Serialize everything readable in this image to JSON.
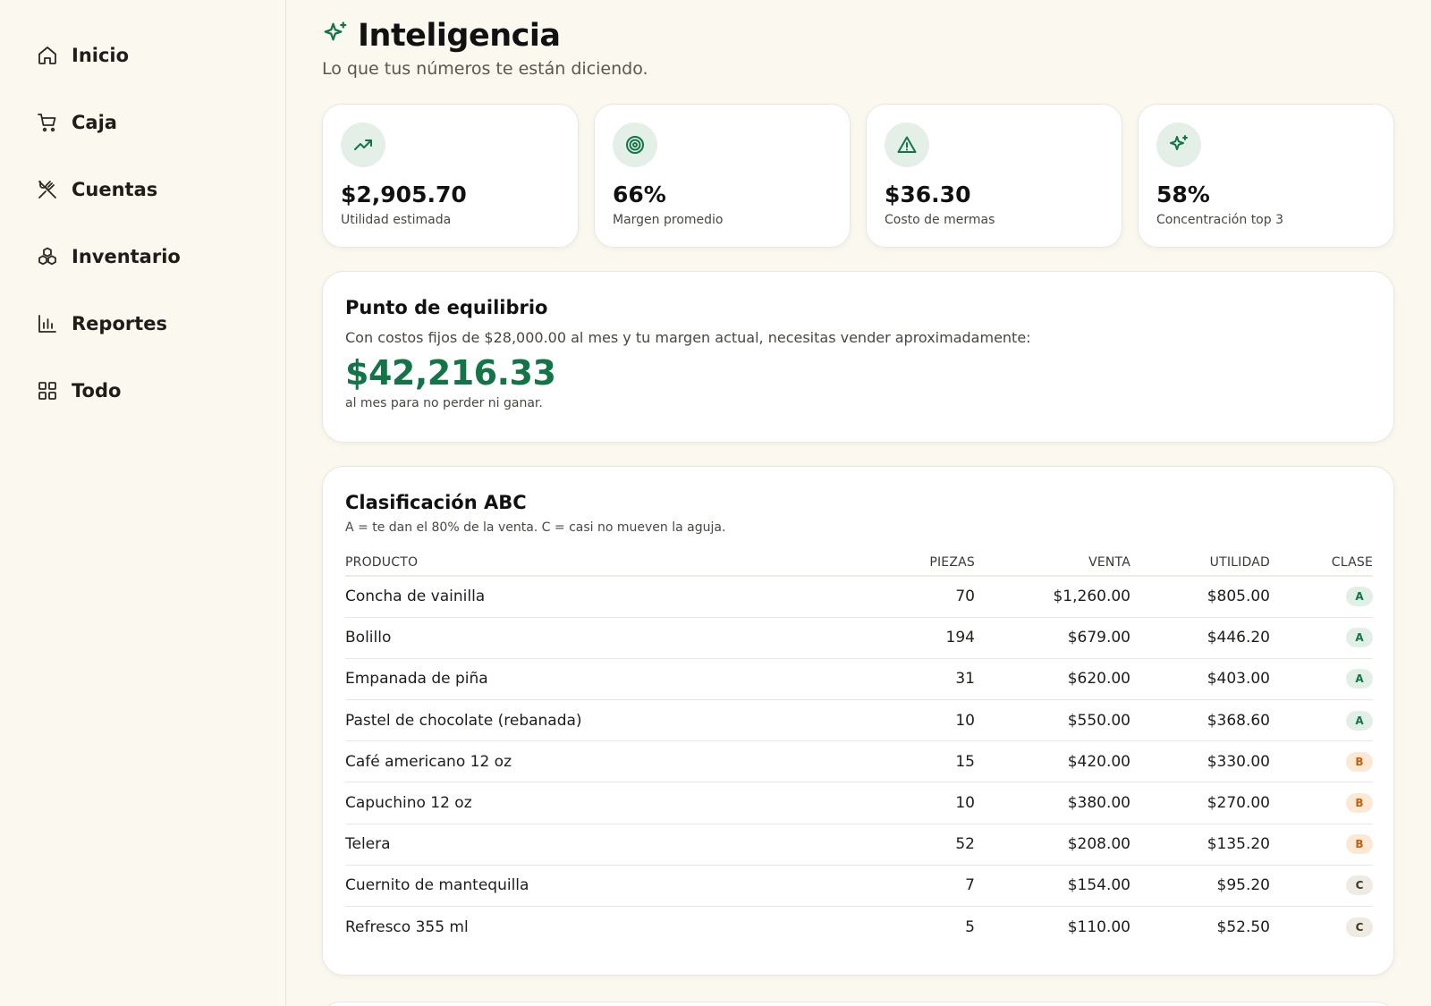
{
  "sidebar": {
    "items": [
      {
        "label": "Inicio",
        "icon": "home-icon"
      },
      {
        "label": "Caja",
        "icon": "cart-icon"
      },
      {
        "label": "Cuentas",
        "icon": "utensils-crossed-icon"
      },
      {
        "label": "Inventario",
        "icon": "boxes-icon"
      },
      {
        "label": "Reportes",
        "icon": "bar-chart-icon"
      },
      {
        "label": "Todo",
        "icon": "grid-icon"
      }
    ]
  },
  "header": {
    "title": "Inteligencia",
    "subtitle": "Lo que tus números te están diciendo.",
    "icon": "sparkles-icon"
  },
  "stats": [
    {
      "value": "$2,905.70",
      "label": "Utilidad estimada",
      "icon": "trending-up-icon"
    },
    {
      "value": "66%",
      "label": "Margen promedio",
      "icon": "target-icon"
    },
    {
      "value": "$36.30",
      "label": "Costo de mermas",
      "icon": "warning-icon"
    },
    {
      "value": "58%",
      "label": "Concentración top 3",
      "icon": "sparkles-icon"
    }
  ],
  "breakeven": {
    "title": "Punto de equilibrio",
    "description": "Con costos fijos de $28,000.00 al mes y tu margen actual, necesitas vender aproximadamente:",
    "value": "$42,216.33",
    "note": "al mes para no perder ni ganar."
  },
  "abc": {
    "title": "Clasificación ABC",
    "description": "A = te dan el 80% de la venta. C = casi no mueven la aguja.",
    "columns": {
      "product": "Producto",
      "pieces": "Piezas",
      "sale": "Venta",
      "profit": "Utilidad",
      "class": "Clase"
    },
    "rows": [
      {
        "product": "Concha de vainilla",
        "pieces": "70",
        "sale": "$1,260.00",
        "profit": "$805.00",
        "class": "A"
      },
      {
        "product": "Bolillo",
        "pieces": "194",
        "sale": "$679.00",
        "profit": "$446.20",
        "class": "A"
      },
      {
        "product": "Empanada de piña",
        "pieces": "31",
        "sale": "$620.00",
        "profit": "$403.00",
        "class": "A"
      },
      {
        "product": "Pastel de chocolate (rebanada)",
        "pieces": "10",
        "sale": "$550.00",
        "profit": "$368.60",
        "class": "A"
      },
      {
        "product": "Café americano 12 oz",
        "pieces": "15",
        "sale": "$420.00",
        "profit": "$330.00",
        "class": "B"
      },
      {
        "product": "Capuchino 12 oz",
        "pieces": "10",
        "sale": "$380.00",
        "profit": "$270.00",
        "class": "B"
      },
      {
        "product": "Telera",
        "pieces": "52",
        "sale": "$208.00",
        "profit": "$135.20",
        "class": "B"
      },
      {
        "product": "Cuernito de mantequilla",
        "pieces": "7",
        "sale": "$154.00",
        "profit": "$95.20",
        "class": "C"
      },
      {
        "product": "Refresco 355 ml",
        "pieces": "5",
        "sale": "$110.00",
        "profit": "$52.50",
        "class": "C"
      }
    ]
  },
  "colors": {
    "accent": "#137547",
    "class_a": "#137547",
    "class_b": "#c2620f",
    "class_c": "#3a3732"
  }
}
